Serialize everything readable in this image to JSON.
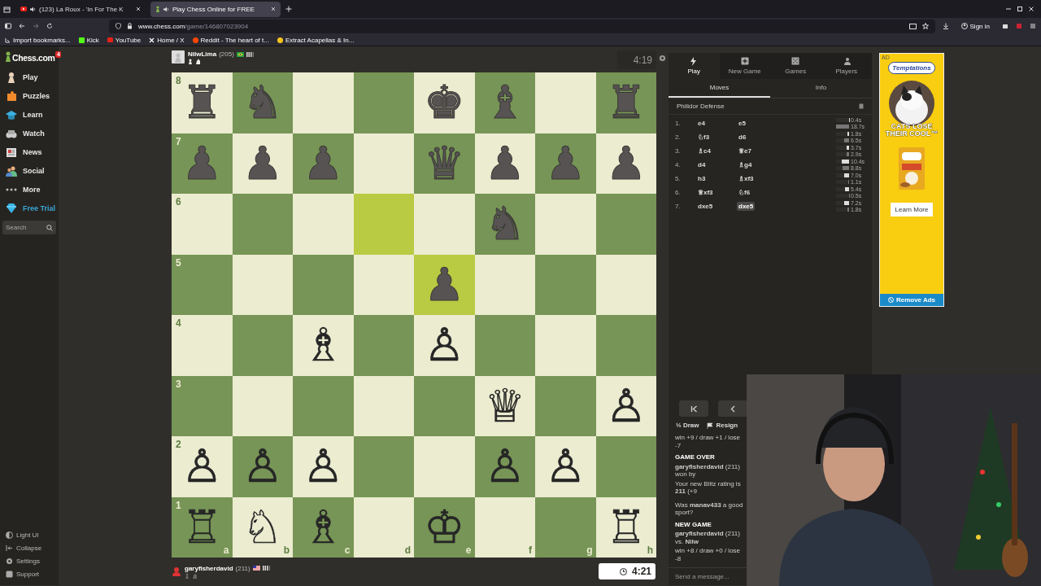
{
  "browser": {
    "tabs": [
      {
        "title": "(123) La Roux - 'In For The K",
        "selected": false
      },
      {
        "title": "Play Chess Online for FREE",
        "selected": true
      }
    ],
    "url": {
      "host": "www.chess.com",
      "path": "/game/146807023904"
    },
    "bookmarks": [
      "Import bookmarks...",
      "Kick",
      "YouTube",
      "Home / X",
      "Reddit - The heart of t...",
      "Extract Acapellas & In..."
    ],
    "sign_in": "Sign in"
  },
  "sidebar": {
    "logo": "Chess.com",
    "badge": "4",
    "items": [
      {
        "label": "Play",
        "kind": "nav"
      },
      {
        "label": "Puzzles",
        "kind": "nav"
      },
      {
        "label": "Learn",
        "kind": "nav"
      },
      {
        "label": "Watch",
        "kind": "nav"
      },
      {
        "label": "News",
        "kind": "nav"
      },
      {
        "label": "Social",
        "kind": "nav"
      },
      {
        "label": "More",
        "kind": "nav"
      },
      {
        "label": "Free Trial",
        "kind": "promo"
      }
    ],
    "search": {
      "placeholder": "Search"
    },
    "footer": [
      "Light UI",
      "Collapse",
      "Settings",
      "Support"
    ]
  },
  "game": {
    "top_player": {
      "name": "NilwLima",
      "rating": "(205)",
      "clock": "4:19",
      "clock_active": false
    },
    "bottom_player": {
      "name": "garyfisherdavid",
      "rating": "(211)",
      "clock": "4:21",
      "clock_active": true
    },
    "board": {
      "file_labels": [
        "a",
        "b",
        "c",
        "d",
        "e",
        "f",
        "g",
        "h"
      ],
      "ranks": [
        {
          "label": "8",
          "squares": [
            {
              "kind": "black",
              "glyph": "♜",
              "highlighted": false
            },
            {
              "kind": "black",
              "glyph": "♞",
              "highlighted": false
            },
            {
              "kind": "empty",
              "highlighted": false
            },
            {
              "kind": "empty",
              "highlighted": false
            },
            {
              "kind": "black",
              "glyph": "♚",
              "highlighted": false
            },
            {
              "kind": "black",
              "glyph": "♝",
              "highlighted": false
            },
            {
              "kind": "empty",
              "highlighted": false
            },
            {
              "kind": "black",
              "glyph": "♜",
              "highlighted": false
            }
          ]
        },
        {
          "label": "7",
          "squares": [
            {
              "kind": "black",
              "glyph": "♟",
              "highlighted": false
            },
            {
              "kind": "black",
              "glyph": "♟",
              "highlighted": false
            },
            {
              "kind": "black",
              "glyph": "♟",
              "highlighted": false
            },
            {
              "kind": "empty",
              "highlighted": false
            },
            {
              "kind": "black",
              "glyph": "♛",
              "highlighted": false
            },
            {
              "kind": "black",
              "glyph": "♟",
              "highlighted": false
            },
            {
              "kind": "black",
              "glyph": "♟",
              "highlighted": false
            },
            {
              "kind": "black",
              "glyph": "♟",
              "highlighted": false
            }
          ]
        },
        {
          "label": "6",
          "squares": [
            {
              "kind": "empty",
              "highlighted": false
            },
            {
              "kind": "empty",
              "highlighted": false
            },
            {
              "kind": "empty",
              "highlighted": false
            },
            {
              "kind": "empty",
              "highlighted": true
            },
            {
              "kind": "empty",
              "highlighted": false
            },
            {
              "kind": "black",
              "glyph": "♞",
              "highlighted": false
            },
            {
              "kind": "empty",
              "highlighted": false
            },
            {
              "kind": "empty",
              "highlighted": false
            }
          ]
        },
        {
          "label": "5",
          "squares": [
            {
              "kind": "empty",
              "highlighted": false
            },
            {
              "kind": "empty",
              "highlighted": false
            },
            {
              "kind": "empty",
              "highlighted": false
            },
            {
              "kind": "empty",
              "highlighted": false
            },
            {
              "kind": "black",
              "glyph": "♟",
              "highlighted": true
            },
            {
              "kind": "empty",
              "highlighted": false
            },
            {
              "kind": "empty",
              "highlighted": false
            },
            {
              "kind": "empty",
              "highlighted": false
            }
          ]
        },
        {
          "label": "4",
          "squares": [
            {
              "kind": "empty",
              "highlighted": false
            },
            {
              "kind": "empty",
              "highlighted": false
            },
            {
              "kind": "white",
              "glyph": "♗",
              "highlighted": false
            },
            {
              "kind": "empty",
              "highlighted": false
            },
            {
              "kind": "white",
              "glyph": "♙",
              "highlighted": false
            },
            {
              "kind": "empty",
              "highlighted": false
            },
            {
              "kind": "empty",
              "highlighted": false
            },
            {
              "kind": "empty",
              "highlighted": false
            }
          ]
        },
        {
          "label": "3",
          "squares": [
            {
              "kind": "empty",
              "highlighted": false
            },
            {
              "kind": "empty",
              "highlighted": false
            },
            {
              "kind": "empty",
              "highlighted": false
            },
            {
              "kind": "empty",
              "highlighted": false
            },
            {
              "kind": "empty",
              "highlighted": false
            },
            {
              "kind": "white",
              "glyph": "♕",
              "highlighted": false
            },
            {
              "kind": "empty",
              "highlighted": false
            },
            {
              "kind": "white",
              "glyph": "♙",
              "highlighted": false
            }
          ]
        },
        {
          "label": "2",
          "squares": [
            {
              "kind": "white",
              "glyph": "♙",
              "highlighted": false
            },
            {
              "kind": "white",
              "glyph": "♙",
              "highlighted": false
            },
            {
              "kind": "white",
              "glyph": "♙",
              "highlighted": false
            },
            {
              "kind": "empty",
              "highlighted": false
            },
            {
              "kind": "empty",
              "highlighted": false
            },
            {
              "kind": "white",
              "glyph": "♙",
              "highlighted": false
            },
            {
              "kind": "white",
              "glyph": "♙",
              "highlighted": false
            },
            {
              "kind": "empty",
              "highlighted": false
            }
          ]
        },
        {
          "label": "1",
          "squares": [
            {
              "kind": "white",
              "glyph": "♖",
              "highlighted": false
            },
            {
              "kind": "white",
              "glyph": "♘",
              "highlighted": false
            },
            {
              "kind": "white",
              "glyph": "♗",
              "highlighted": false
            },
            {
              "kind": "empty",
              "highlighted": false
            },
            {
              "kind": "white",
              "glyph": "♔",
              "highlighted": false
            },
            {
              "kind": "empty",
              "highlighted": false
            },
            {
              "kind": "empty",
              "highlighted": false
            },
            {
              "kind": "white",
              "glyph": "♖",
              "highlighted": false
            }
          ]
        }
      ]
    }
  },
  "panel": {
    "nav": [
      {
        "label": "Play",
        "selected": true
      },
      {
        "label": "New Game",
        "selected": false
      },
      {
        "label": "Games",
        "selected": false
      },
      {
        "label": "Players",
        "selected": false
      }
    ],
    "tabs": [
      {
        "label": "Moves",
        "selected": true
      },
      {
        "label": "Info",
        "selected": false
      }
    ],
    "opening": "Philidor Defense",
    "moves": [
      {
        "number": "1.",
        "white": {
          "text": "e4",
          "selected": false
        },
        "black": {
          "text": "e5",
          "selected": false
        },
        "white_time": {
          "text": "0.4s",
          "level": 0.02
        },
        "black_time": {
          "text": "18.7s",
          "level": 1
        }
      },
      {
        "number": "2.",
        "white": {
          "text": "♘f3",
          "selected": false
        },
        "black": {
          "text": "d6",
          "selected": false
        },
        "white_time": {
          "text": "1.8s",
          "level": 0.1
        },
        "black_time": {
          "text": "6.5s",
          "level": 0.35
        }
      },
      {
        "number": "3.",
        "white": {
          "text": "♗c4",
          "selected": false
        },
        "black": {
          "text": "♕e7",
          "selected": false
        },
        "white_time": {
          "text": "3.7s",
          "level": 0.2
        },
        "black_time": {
          "text": "2.9s",
          "level": 0.16
        }
      },
      {
        "number": "4.",
        "white": {
          "text": "d4",
          "selected": false
        },
        "black": {
          "text": "♗g4",
          "selected": false
        },
        "white_time": {
          "text": "10.4s",
          "level": 0.56
        },
        "black_time": {
          "text": "8.8s",
          "level": 0.47
        }
      },
      {
        "number": "5.",
        "white": {
          "text": "h3",
          "selected": false
        },
        "black": {
          "text": "♗xf3",
          "selected": false
        },
        "white_time": {
          "text": "7.0s",
          "level": 0.37
        },
        "black_time": {
          "text": "1.1s",
          "level": 0.06
        }
      },
      {
        "number": "6.",
        "white": {
          "text": "♕xf3",
          "selected": false
        },
        "black": {
          "text": "♘f6",
          "selected": false
        },
        "white_time": {
          "text": "5.4s",
          "level": 0.29
        },
        "black_time": {
          "text": "0.5s",
          "level": 0.03
        }
      },
      {
        "number": "7.",
        "white": {
          "text": "dxe5",
          "selected": false
        },
        "black": {
          "text": "dxe5",
          "selected": true
        },
        "white_time": {
          "text": "7.2s",
          "level": 0.39
        },
        "black_time": {
          "text": "1.8s",
          "level": 0.1
        }
      }
    ],
    "actions": [
      {
        "symbol": "½",
        "label": "Draw",
        "kind": "draw"
      },
      {
        "label": "Resign",
        "kind": "resign"
      }
    ],
    "chat": [
      {
        "kind": "line",
        "text": "win +9 / draw +1 / lose -7"
      },
      {
        "kind": "heading",
        "text": "GAME OVER"
      },
      {
        "kind": "line",
        "text": "**garyfisherdavid** (211) won by"
      },
      {
        "kind": "line",
        "text": "Your new Blitz rating is **211** (+9"
      },
      {
        "kind": "gap",
        "text": "Was **manav433** a good sport?"
      },
      {
        "kind": "heading",
        "text": "NEW GAME"
      },
      {
        "kind": "line",
        "text": "**garyfisherdavid** (211) vs. **Nilw**"
      },
      {
        "kind": "line",
        "text": "win +8 / draw +0 / lose -8"
      }
    ],
    "message": {
      "placeholder": "Send a message..."
    }
  },
  "ad": {
    "tag": "AD",
    "brand": "Temptations",
    "headline": "CATS LOSE THEIR COOL™",
    "button": "Learn More",
    "remove": "Remove Ads"
  }
}
